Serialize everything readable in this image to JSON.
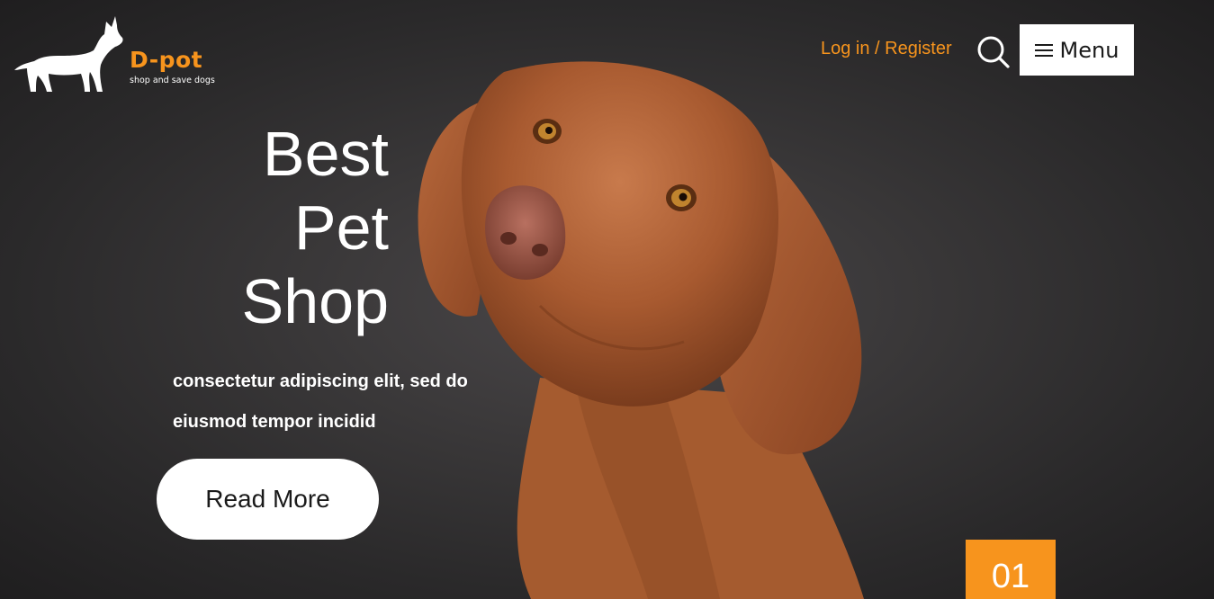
{
  "brand": {
    "name": "D-pot",
    "tagline": "shop and save dogs",
    "logo_icon": "dog-silhouette-icon",
    "accent_color": "#f7941d"
  },
  "header": {
    "login_label": "Log in / Register",
    "search_icon": "search-icon",
    "menu_icon": "hamburger-icon",
    "menu_label": "Menu"
  },
  "hero": {
    "headline_lines": [
      "Best",
      "Pet",
      "Shop"
    ],
    "subtitle_lines": [
      "consectetur adipiscing elit, sed do",
      "eiusmod tempor incidid"
    ],
    "cta_label": "Read More",
    "slide_number": "01"
  }
}
